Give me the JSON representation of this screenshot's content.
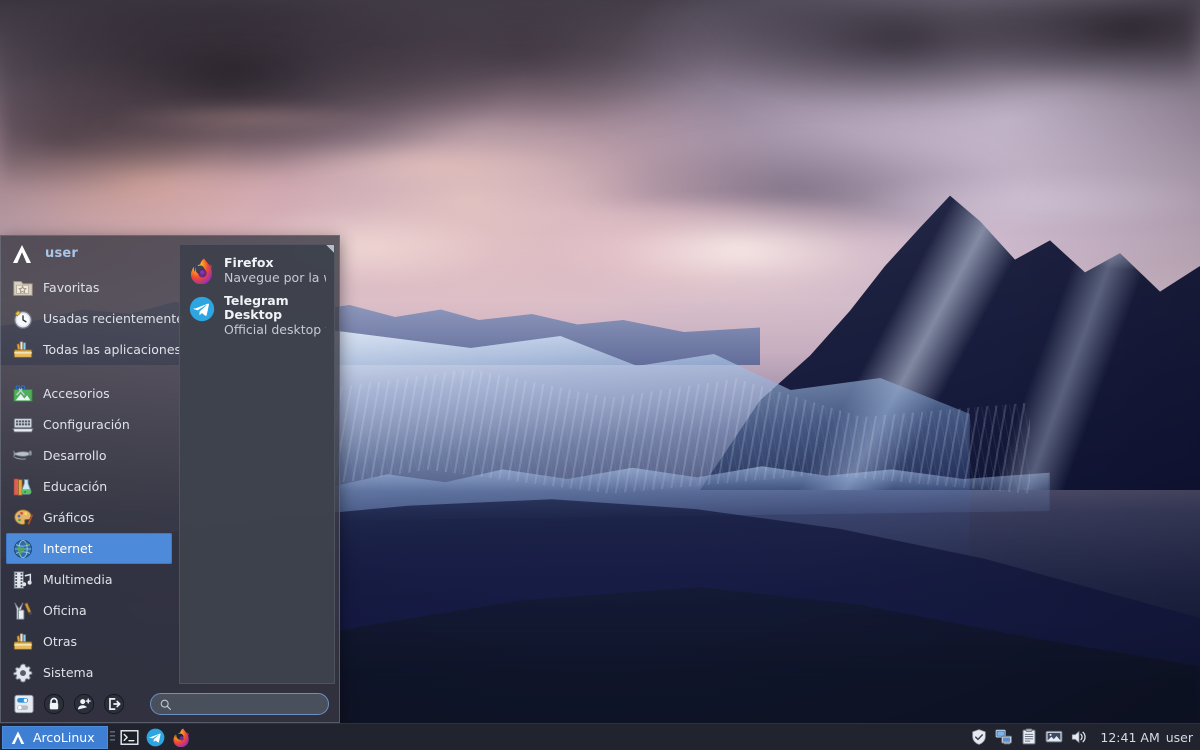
{
  "desktop": {
    "wallpaper_description": "mountain-glacier-sunset-wallpaper"
  },
  "menu": {
    "header": {
      "logo_icon": "arcolinux-logo-icon",
      "user": "user"
    },
    "groups": [
      {
        "items": [
          {
            "label": "Favoritas",
            "icon": "favorites-folder-icon",
            "selected": false
          },
          {
            "label": "Usadas recientemente",
            "icon": "clock-icon",
            "selected": false
          },
          {
            "label": "Todas las aplicaciones",
            "icon": "all-applications-icon",
            "selected": false
          }
        ]
      },
      {
        "items": [
          {
            "label": "Accesorios",
            "icon": "accessories-icon",
            "selected": false
          },
          {
            "label": "Configuración",
            "icon": "settings-icon",
            "selected": false
          },
          {
            "label": "Desarrollo",
            "icon": "development-icon",
            "selected": false
          },
          {
            "label": "Educación",
            "icon": "education-icon",
            "selected": false
          },
          {
            "label": "Gráficos",
            "icon": "graphics-palette-icon",
            "selected": false
          },
          {
            "label": "Internet",
            "icon": "internet-globe-icon",
            "selected": true
          },
          {
            "label": "Multimedia",
            "icon": "multimedia-film-icon",
            "selected": false
          },
          {
            "label": "Oficina",
            "icon": "office-icon",
            "selected": false
          },
          {
            "label": "Otras",
            "icon": "other-toolbox-icon",
            "selected": false
          },
          {
            "label": "Sistema",
            "icon": "system-gear-icon",
            "selected": false
          }
        ]
      }
    ],
    "apps": [
      {
        "name": "Firefox",
        "desc": "Navegue por la web",
        "icon": "firefox-icon"
      },
      {
        "name": "Telegram Desktop",
        "desc": "Official desktop vers...",
        "icon": "telegram-icon"
      }
    ],
    "bottom_buttons": [
      {
        "name": "settings-button",
        "icon": "toggle-switches-icon"
      },
      {
        "name": "lock-screen-button",
        "icon": "padlock-icon"
      },
      {
        "name": "switch-user-button",
        "icon": "switch-user-icon"
      },
      {
        "name": "log-out-button",
        "icon": "logout-icon"
      }
    ],
    "search": {
      "value": "",
      "placeholder": "",
      "icon": "search-icon"
    }
  },
  "taskbar": {
    "window_button": {
      "label": "ArcoLinux",
      "icon": "arcolinux-logo-icon"
    },
    "launchers": [
      {
        "name": "terminal-launcher",
        "icon": "terminal-icon"
      },
      {
        "name": "telegram-launcher",
        "icon": "telegram-icon"
      },
      {
        "name": "firefox-launcher",
        "icon": "firefox-icon"
      }
    ],
    "tray": [
      {
        "name": "security-shield-tray-icon",
        "icon": "shield-check-icon"
      },
      {
        "name": "network-tray-icon",
        "icon": "network-computers-icon"
      },
      {
        "name": "clipboard-tray-icon",
        "icon": "clipboard-icon"
      },
      {
        "name": "display-tray-icon",
        "icon": "monitor-icon"
      },
      {
        "name": "volume-tray-icon",
        "icon": "speaker-icon"
      }
    ],
    "clock": "12:41 AM",
    "user": "user"
  },
  "colors": {
    "accent_blue": "#4d8ad9",
    "taskbar_bg": "#21242e",
    "menu_bg": "#3a3a44",
    "selected_text": "#ffffff"
  }
}
